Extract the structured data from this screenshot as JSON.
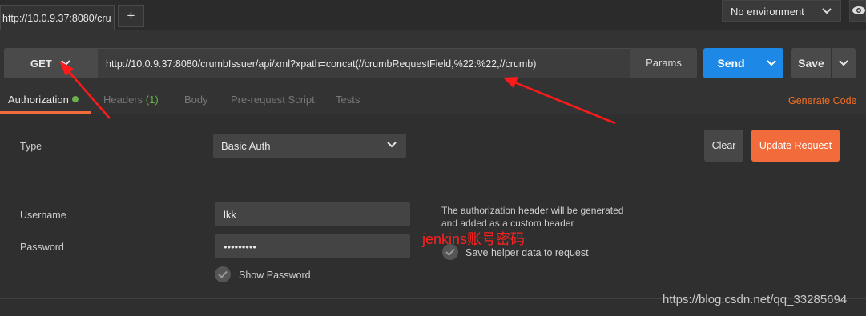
{
  "tab": {
    "title": "http://10.0.9.37:8080/cru",
    "add_label": "+"
  },
  "environment": {
    "selected": "No environment",
    "icons": {
      "dropdown": "chevron-down-icon",
      "eye": "eye-icon"
    }
  },
  "request": {
    "method": "GET",
    "url": "http://10.0.9.37:8080/crumbIssuer/api/xml?xpath=concat(//crumbRequestField,%22:%22,//crumb)",
    "params_label": "Params",
    "send_label": "Send",
    "save_label": "Save"
  },
  "subtabs": [
    {
      "label": "Authorization",
      "active": true
    },
    {
      "label": "Headers",
      "count": "(1)"
    },
    {
      "label": "Body"
    },
    {
      "label": "Pre-request Script"
    },
    {
      "label": "Tests"
    }
  ],
  "generate_code_label": "Generate Code",
  "auth": {
    "type_label": "Type",
    "type_value": "Basic Auth",
    "clear_label": "Clear",
    "update_label": "Update Request",
    "username_label": "Username",
    "username_value": "lkk",
    "password_label": "Password",
    "password_value": "•••••••••",
    "show_password_label": "Show Password",
    "note": "The authorization header will be generated and added as a custom header",
    "save_helper_label": "Save helper data to request"
  },
  "annotation_text": "jenkins账号密码",
  "watermark": "https://blog.csdn.net/qq_33285694",
  "colors": {
    "accent": "#f26b3a",
    "send": "#1d88e5",
    "active_dot": "#6ab04c",
    "annotation": "#ff2020"
  }
}
